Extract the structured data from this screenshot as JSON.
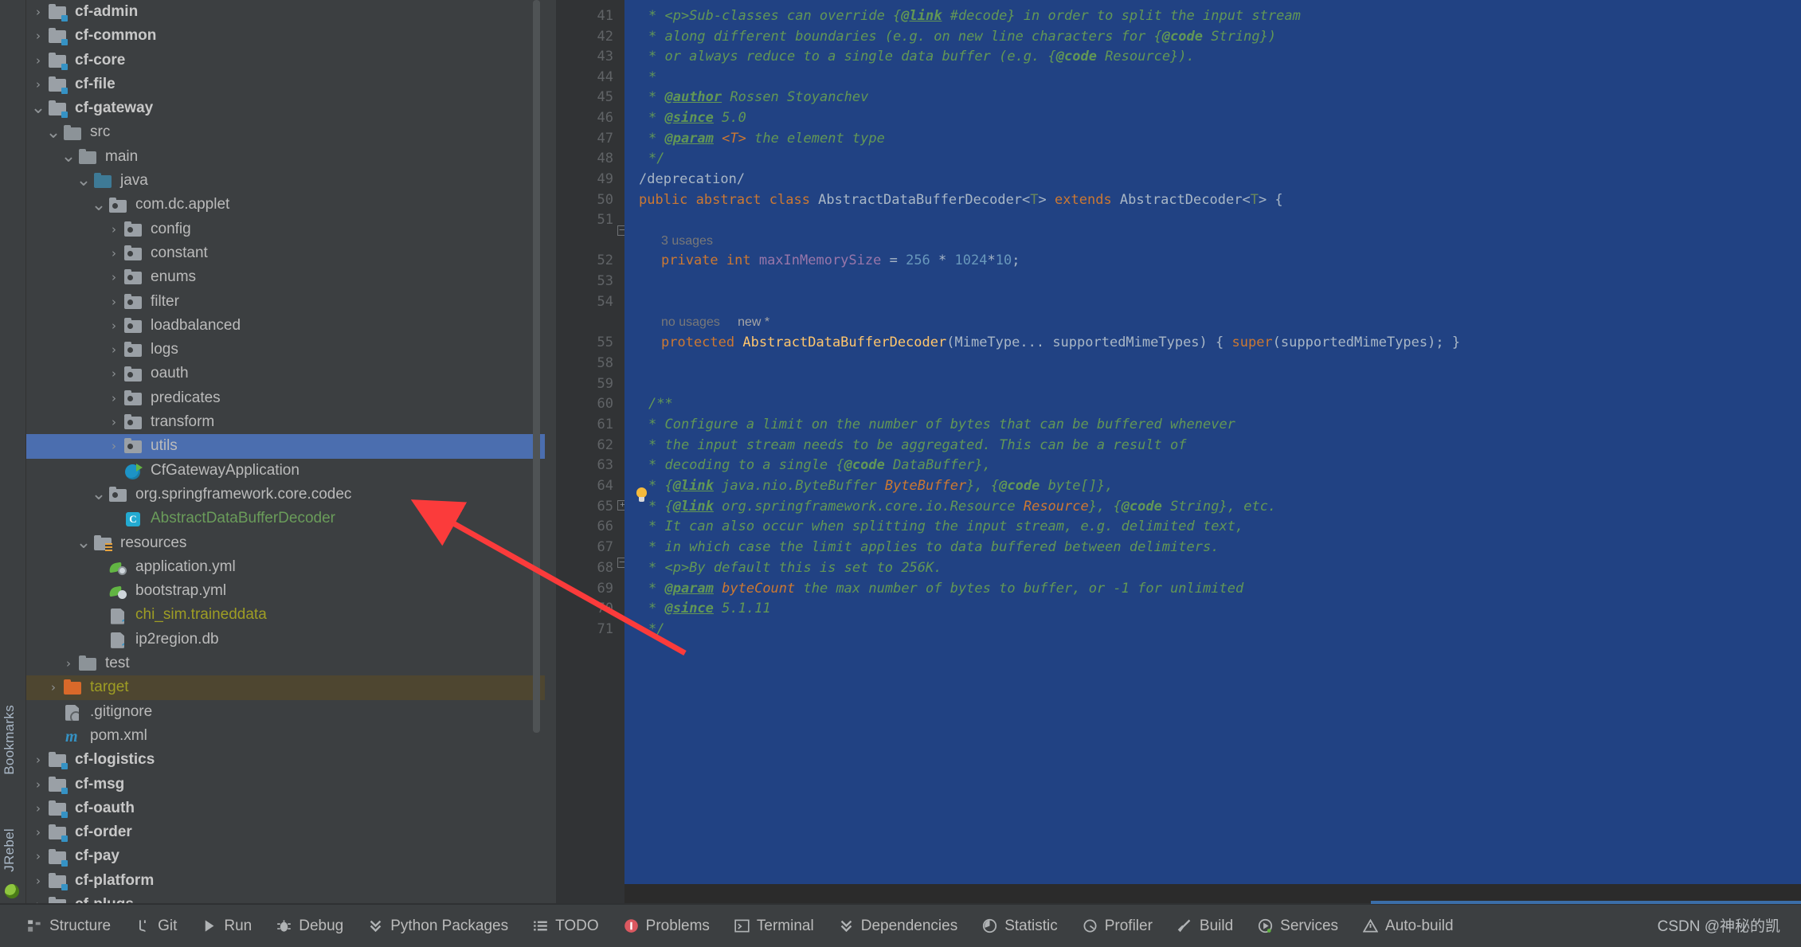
{
  "left_strip": {
    "bookmarks_label": "Bookmarks",
    "jrebel_label": "JRebel"
  },
  "project_tree": {
    "items": [
      {
        "label": "cf-admin",
        "depth": 1,
        "arrow": "collapsed",
        "icon": "module-folder-icon",
        "style": "bold"
      },
      {
        "label": "cf-common",
        "depth": 1,
        "arrow": "collapsed",
        "icon": "module-folder-icon",
        "style": "bold"
      },
      {
        "label": "cf-core",
        "depth": 1,
        "arrow": "collapsed",
        "icon": "module-folder-icon",
        "style": "bold"
      },
      {
        "label": "cf-file",
        "depth": 1,
        "arrow": "collapsed",
        "icon": "module-folder-icon",
        "style": "bold"
      },
      {
        "label": "cf-gateway",
        "depth": 1,
        "arrow": "expanded",
        "icon": "module-folder-icon",
        "style": "bold"
      },
      {
        "label": "src",
        "depth": 2,
        "arrow": "expanded",
        "icon": "folder-icon",
        "style": "normal"
      },
      {
        "label": "main",
        "depth": 3,
        "arrow": "expanded",
        "icon": "folder-icon",
        "style": "normal"
      },
      {
        "label": "java",
        "depth": 4,
        "arrow": "expanded",
        "icon": "java-source-folder-icon",
        "style": "normal"
      },
      {
        "label": "com.dc.applet",
        "depth": 5,
        "arrow": "expanded",
        "icon": "package-icon",
        "style": "normal"
      },
      {
        "label": "config",
        "depth": 6,
        "arrow": "collapsed",
        "icon": "package-icon",
        "style": "normal"
      },
      {
        "label": "constant",
        "depth": 6,
        "arrow": "collapsed",
        "icon": "package-icon",
        "style": "normal"
      },
      {
        "label": "enums",
        "depth": 6,
        "arrow": "collapsed",
        "icon": "package-icon",
        "style": "normal"
      },
      {
        "label": "filter",
        "depth": 6,
        "arrow": "collapsed",
        "icon": "package-icon",
        "style": "normal"
      },
      {
        "label": "loadbalanced",
        "depth": 6,
        "arrow": "collapsed",
        "icon": "package-icon",
        "style": "normal"
      },
      {
        "label": "logs",
        "depth": 6,
        "arrow": "collapsed",
        "icon": "package-icon",
        "style": "normal"
      },
      {
        "label": "oauth",
        "depth": 6,
        "arrow": "collapsed",
        "icon": "package-icon",
        "style": "normal"
      },
      {
        "label": "predicates",
        "depth": 6,
        "arrow": "collapsed",
        "icon": "package-icon",
        "style": "normal"
      },
      {
        "label": "transform",
        "depth": 6,
        "arrow": "collapsed",
        "icon": "package-icon",
        "style": "normal"
      },
      {
        "label": "utils",
        "depth": 6,
        "arrow": "collapsed",
        "icon": "package-icon",
        "style": "normal",
        "state": "selected"
      },
      {
        "label": "CfGatewayApplication",
        "depth": 6,
        "arrow": "none",
        "icon": "spring-boot-class-icon",
        "style": "normal"
      },
      {
        "label": "org.springframework.core.codec",
        "depth": 5,
        "arrow": "expanded",
        "icon": "package-icon",
        "style": "normal"
      },
      {
        "label": "AbstractDataBufferDecoder",
        "depth": 6,
        "arrow": "none",
        "icon": "java-class-icon",
        "style": "green"
      },
      {
        "label": "resources",
        "depth": 4,
        "arrow": "expanded",
        "icon": "resources-folder-icon",
        "style": "normal"
      },
      {
        "label": "application.yml",
        "depth": 5,
        "arrow": "none",
        "icon": "spring-yaml-icon",
        "style": "normal"
      },
      {
        "label": "bootstrap.yml",
        "depth": 5,
        "arrow": "none",
        "icon": "spring-cloud-yaml-icon",
        "style": "normal"
      },
      {
        "label": "chi_sim.traineddata",
        "depth": 5,
        "arrow": "none",
        "icon": "unknown-file-icon",
        "style": "yellow"
      },
      {
        "label": "ip2region.db",
        "depth": 5,
        "arrow": "none",
        "icon": "unknown-file-icon",
        "style": "normal"
      },
      {
        "label": "test",
        "depth": 3,
        "arrow": "collapsed",
        "icon": "folder-icon",
        "style": "normal"
      },
      {
        "label": "target",
        "depth": 2,
        "arrow": "collapsed",
        "icon": "target-folder-icon",
        "style": "orange-t",
        "state": "hover"
      },
      {
        "label": ".gitignore",
        "depth": 2,
        "arrow": "none",
        "icon": "gitignore-file-icon",
        "style": "normal"
      },
      {
        "label": "pom.xml",
        "depth": 2,
        "arrow": "none",
        "icon": "maven-file-icon",
        "style": "normal"
      },
      {
        "label": "cf-logistics",
        "depth": 1,
        "arrow": "collapsed",
        "icon": "module-folder-icon",
        "style": "bold"
      },
      {
        "label": "cf-msg",
        "depth": 1,
        "arrow": "collapsed",
        "icon": "module-folder-icon",
        "style": "bold"
      },
      {
        "label": "cf-oauth",
        "depth": 1,
        "arrow": "collapsed",
        "icon": "module-folder-icon",
        "style": "bold"
      },
      {
        "label": "cf-order",
        "depth": 1,
        "arrow": "collapsed",
        "icon": "module-folder-icon",
        "style": "bold"
      },
      {
        "label": "cf-pay",
        "depth": 1,
        "arrow": "collapsed",
        "icon": "module-folder-icon",
        "style": "bold"
      },
      {
        "label": "cf-platform",
        "depth": 1,
        "arrow": "collapsed",
        "icon": "module-folder-icon",
        "style": "bold"
      },
      {
        "label": "cf-plugs",
        "depth": 1,
        "arrow": "collapsed",
        "icon": "module-folder-icon",
        "style": "bold"
      }
    ]
  },
  "editor": {
    "line_numbers": [
      "41",
      "42",
      "43",
      "44",
      "45",
      "46",
      "47",
      "48",
      "49",
      "50",
      "51",
      "52",
      "53",
      "54",
      "55",
      "58",
      "59",
      "60",
      "61",
      "62",
      "63",
      "64",
      "65",
      "66",
      "67",
      "68",
      "69",
      "70",
      "71"
    ],
    "inlay_hints": {
      "usages_3": "3 usages",
      "no_usages": "no usages",
      "new_star": "new *"
    },
    "code_lines": [
      "* <p>Sub-classes can override {@link #decode} in order to split the input stream",
      "* along different boundaries (e.g. on new line characters for {@code String})",
      "* or always reduce to a single data buffer (e.g. {@code Resource}).",
      "*",
      "* @author Rossen Stoyanchev",
      "* @since 5.0",
      "* @param <T> the element type",
      "*/",
      "/deprecation/",
      "public abstract class AbstractDataBufferDecoder<T> extends AbstractDecoder<T> {",
      "private int maxInMemorySize = 256 * 1024*10;",
      "protected AbstractDataBufferDecoder(MimeType... supportedMimeTypes) { super(supportedMimeTypes); }",
      "/**",
      "* Configure a limit on the number of bytes that can be buffered whenever",
      "* the input stream needs to be aggregated. This can be a result of",
      "* decoding to a single {@code DataBuffer},",
      "* {@link java.nio.ByteBuffer ByteBuffer}, {@code byte[]},",
      "* {@link org.springframework.core.io.Resource Resource}, {@code String}, etc.",
      "* It can also occur when splitting the input stream, e.g. delimited text,",
      "* in which case the limit applies to data buffered between delimiters.",
      "* <p>By default this is set to 256K.",
      "* @param byteCount the max number of bytes to buffer, or -1 for unlimited",
      "* @since 5.1.11",
      "*/"
    ]
  },
  "bottom_bar": {
    "tools": [
      {
        "label": "Structure",
        "icon": "structure-icon"
      },
      {
        "label": "Git",
        "icon": "git-branch-icon"
      },
      {
        "label": "Run",
        "icon": "run-play-icon"
      },
      {
        "label": "Debug",
        "icon": "debug-bug-icon"
      },
      {
        "label": "Python Packages",
        "icon": "python-packages-icon"
      },
      {
        "label": "TODO",
        "icon": "todo-list-icon"
      },
      {
        "label": "Problems",
        "icon": "problems-error-icon"
      },
      {
        "label": "Terminal",
        "icon": "terminal-icon"
      },
      {
        "label": "Dependencies",
        "icon": "dependencies-icon"
      },
      {
        "label": "Statistic",
        "icon": "statistic-icon"
      },
      {
        "label": "Profiler",
        "icon": "profiler-icon"
      },
      {
        "label": "Build",
        "icon": "build-hammer-icon"
      },
      {
        "label": "Services",
        "icon": "services-icon"
      },
      {
        "label": "Auto-build",
        "icon": "auto-build-warning-icon"
      }
    ],
    "watermark": "CSDN @神秘的凯"
  },
  "colors": {
    "selection_blue": "#4b6eaf",
    "editor_selection": "#214283",
    "hover_brown": "#4e4630",
    "keyword_orange": "#cc7832",
    "comment_green": "#629755",
    "string_green": "#6a8759",
    "number_blue": "#6897bb",
    "field_purple": "#9876aa",
    "annotation_arrow_red": "#fb3b3b"
  }
}
